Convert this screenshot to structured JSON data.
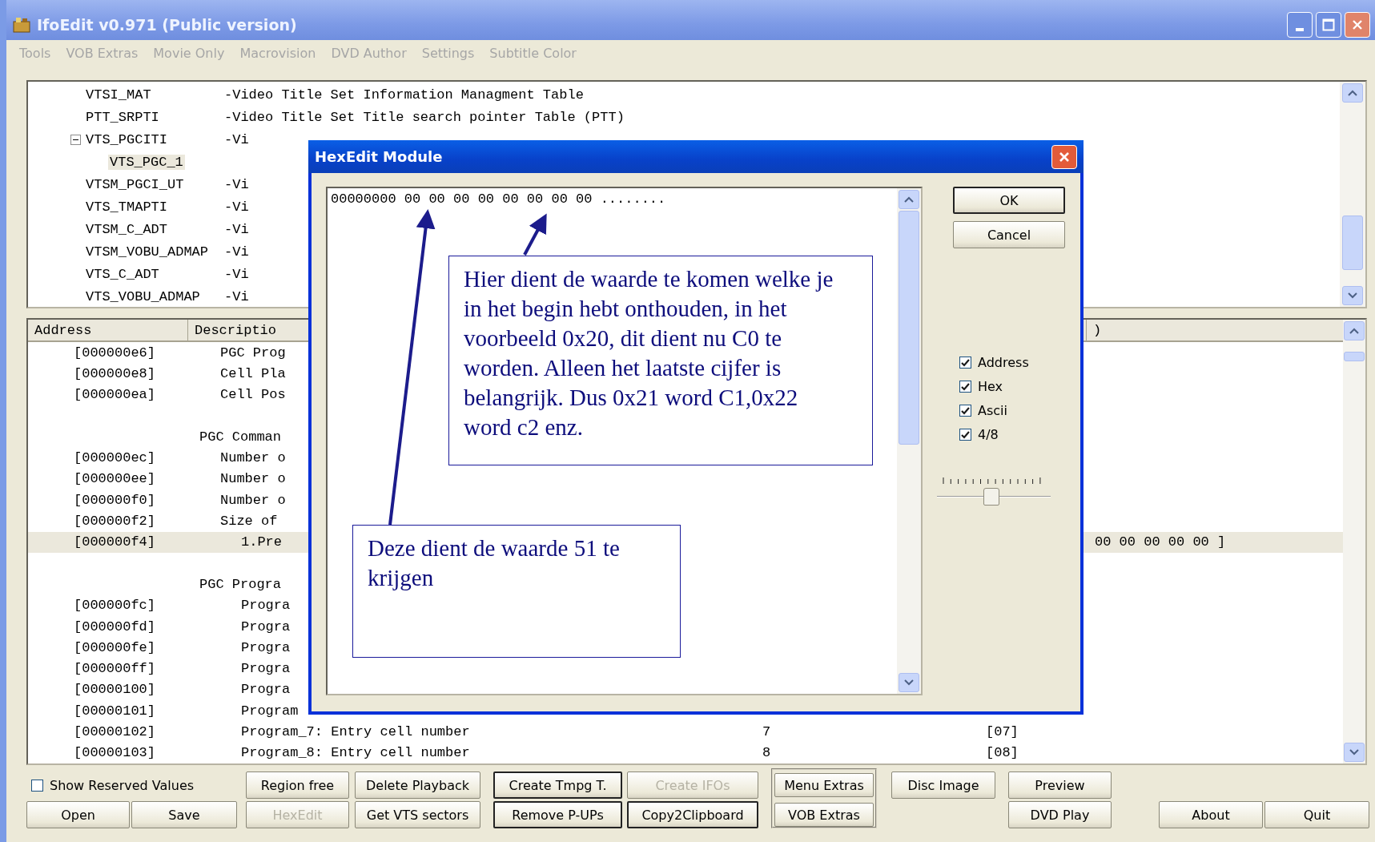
{
  "window": {
    "title": "IfoEdit v0.971 (Public version)"
  },
  "menu": [
    "Tools",
    "VOB Extras",
    "Movie Only",
    "Macrovision",
    "DVD Author",
    "Settings",
    "Subtitle Color"
  ],
  "tree": [
    {
      "name": "VTSI_MAT",
      "description": "-Video Title Set Information Managment Table",
      "selected": false
    },
    {
      "name": "PTT_SRPTI",
      "description": "-Video Title Set Title search pointer Table (PTT)",
      "selected": false
    },
    {
      "name": "VTS_PGCITI",
      "description": "-Vi",
      "selected": false,
      "expanded": true,
      "children": [
        {
          "name": "VTS_PGC_1",
          "selected": true
        }
      ]
    },
    {
      "name": "VTSM_PGCI_UT",
      "description": "-Vi",
      "selected": false
    },
    {
      "name": "VTS_TMAPTI",
      "description": "-Vi",
      "selected": false
    },
    {
      "name": "VTSM_C_ADT",
      "description": "-Vi",
      "selected": false
    },
    {
      "name": "VTSM_VOBU_ADMAP",
      "description": "-Vi",
      "selected": false
    },
    {
      "name": "VTS_C_ADT",
      "description": "-Vi",
      "selected": false
    },
    {
      "name": "VTS_VOBU_ADMAP",
      "description": "-Vi",
      "selected": false
    }
  ],
  "table": {
    "columns": [
      "Address",
      "Descriptio",
      ")"
    ],
    "rows": [
      {
        "kind": "field",
        "address": "[000000e6]",
        "description": "PGC Prog",
        "selected": false
      },
      {
        "kind": "field",
        "address": "[000000e8]",
        "description": "Cell Pla",
        "selected": false
      },
      {
        "kind": "field",
        "address": "[000000ea]",
        "description": "Cell Pos",
        "selected": false
      },
      {
        "kind": "blank"
      },
      {
        "kind": "section",
        "description": "PGC Comman"
      },
      {
        "kind": "field",
        "address": "[000000ec]",
        "description": "Number o",
        "selected": false
      },
      {
        "kind": "field",
        "address": "[000000ee]",
        "description": "Number o",
        "selected": false
      },
      {
        "kind": "field",
        "address": "[000000f0]",
        "description": "Number o",
        "selected": false
      },
      {
        "kind": "field",
        "address": "[000000f2]",
        "description": "Size of",
        "selected": false
      },
      {
        "kind": "item",
        "address": "[000000f4]",
        "description": "1.Pre",
        "hex": "00 00 00 00 00 ]",
        "selected": true
      },
      {
        "kind": "blank"
      },
      {
        "kind": "section",
        "description": "PGC Progra"
      },
      {
        "kind": "item",
        "address": "[000000fc]",
        "description": "Progra",
        "selected": false
      },
      {
        "kind": "item",
        "address": "[000000fd]",
        "description": "Progra",
        "selected": false
      },
      {
        "kind": "item",
        "address": "[000000fe]",
        "description": "Progra",
        "selected": false
      },
      {
        "kind": "item",
        "address": "[000000ff]",
        "description": "Progra",
        "selected": false
      },
      {
        "kind": "item",
        "address": "[00000100]",
        "description": "Progra",
        "selected": false
      },
      {
        "kind": "item",
        "address": "[00000101]",
        "description": "Program",
        "selected": false
      },
      {
        "kind": "item",
        "address": "[00000102]",
        "description": "Program_7: Entry cell number",
        "value": "7",
        "hex": "[07]",
        "selected": false
      },
      {
        "kind": "item",
        "address": "[00000103]",
        "description": "Program_8: Entry cell number",
        "value": "8",
        "hex": "[08]",
        "selected": false
      }
    ]
  },
  "bottom": {
    "rows": [
      [
        {
          "kind": "checkbox",
          "label": "Show Reserved Values",
          "checked": false
        },
        "",
        {
          "label": "Region free",
          "disabled": false,
          "outlined": false
        },
        {
          "label": "Delete Playback",
          "disabled": false,
          "outlined": false
        },
        {
          "label": "Create Tmpg T.",
          "disabled": false,
          "outlined": true
        },
        {
          "label": "Create IFOs",
          "disabled": true,
          "outlined": false
        },
        {
          "label": "Menu Extras",
          "disabled": false,
          "outlined": false
        },
        {
          "label": "Disc Image",
          "disabled": false,
          "outlined": false
        },
        {
          "label": "Preview",
          "disabled": false,
          "outlined": false
        },
        "",
        ""
      ],
      [
        {
          "label": "Open",
          "disabled": false,
          "outlined": false
        },
        {
          "label": "Save",
          "disabled": false,
          "outlined": false
        },
        {
          "label": "HexEdit",
          "disabled": true,
          "outlined": false
        },
        {
          "label": "Get VTS sectors",
          "disabled": false,
          "outlined": false
        },
        {
          "label": "Remove P-UPs",
          "disabled": false,
          "outlined": true
        },
        {
          "label": "Copy2Clipboard",
          "disabled": false,
          "outlined": true
        },
        {
          "label": "VOB Extras",
          "disabled": false,
          "outlined": false
        },
        "",
        {
          "label": "DVD Play",
          "disabled": false,
          "outlined": false
        },
        {
          "label": "About",
          "disabled": false,
          "outlined": false
        },
        {
          "label": "Quit",
          "disabled": false,
          "outlined": false
        }
      ]
    ]
  },
  "dialog": {
    "title": "HexEdit Module",
    "hex_line": "00000000 00 00 00 00 00 00 00 00 ........",
    "buttons": [
      "OK",
      "Cancel"
    ],
    "options": [
      {
        "label": "Address",
        "checked": true
      },
      {
        "label": "Hex",
        "checked": true
      },
      {
        "label": "Ascii",
        "checked": true
      },
      {
        "label": "4/8",
        "checked": true
      }
    ],
    "slider": {
      "level": 0.48
    },
    "notes": [
      "Hier dient de waarde te komen welke je in het begin hebt onthouden, in het voorbeeld 0x20, dit dient nu C0 te worden. Alleen het laatste cijfer is belangrijk. Dus 0x21 word C1,0x22 word c2 enz.",
      "Deze dient de waarde 51 te krijgen"
    ]
  }
}
